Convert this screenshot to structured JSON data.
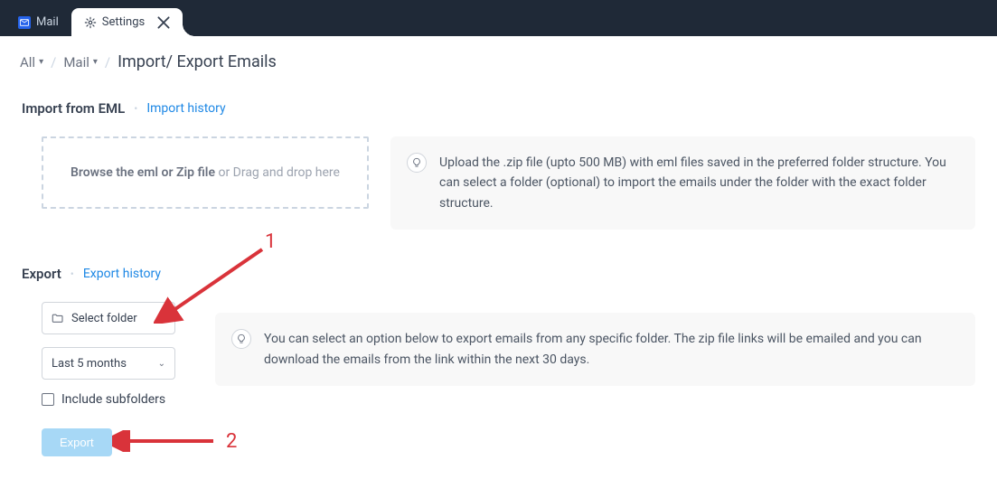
{
  "tabs": {
    "mail": "Mail",
    "settings": "Settings"
  },
  "breadcrumb": {
    "all": "All",
    "mail": "Mail",
    "title": "Import/ Export Emails"
  },
  "import": {
    "heading": "Import from EML",
    "history_link": "Import history",
    "dropzone_strong": "Browse the eml or Zip file",
    "dropzone_rest": " or Drag and drop here",
    "tip": "Upload the .zip file (upto 500 MB) with eml files saved in the preferred folder structure. You can select a folder (optional) to import the emails under the folder with the exact folder structure."
  },
  "export": {
    "heading": "Export",
    "history_link": "Export history",
    "folder_placeholder": "Select folder",
    "period_value": "Last 5 months",
    "include_subfolders": "Include subfolders",
    "button": "Export",
    "tip": "You can select an option below to export emails from any specific folder. The zip file links will be emailed and you can download the emails from the link within the next 30 days."
  },
  "annotations": {
    "n1": "1",
    "n2": "2"
  }
}
